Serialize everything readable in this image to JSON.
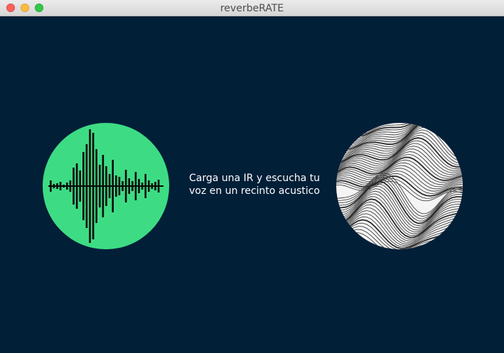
{
  "window": {
    "title": "reverbeRATE"
  },
  "colors": {
    "background": "#021f38",
    "accent_green": "#3ddc84",
    "text": "#ffffff"
  },
  "icons": {
    "left": "waveform-icon",
    "right": "wave-texture-icon"
  },
  "prompt": {
    "line1": "Carga una IR y escucha tu",
    "line2": "voz en un recinto acustico"
  }
}
